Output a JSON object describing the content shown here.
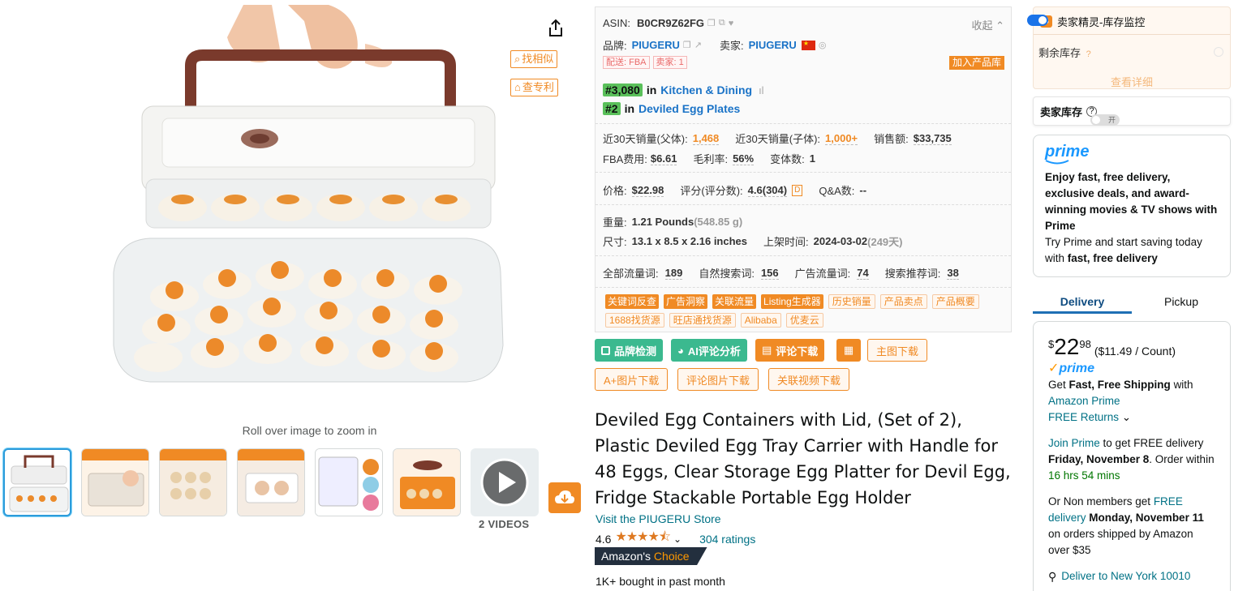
{
  "media": {
    "share_icon": "share-icon",
    "find_similar": "找相似",
    "check_patent": "查专利",
    "zoom_hint": "Roll over image to zoom in",
    "videos_label": "2 VIDEOS"
  },
  "plugin": {
    "asin_label": "ASIN:",
    "asin": "B0CR9Z62FG",
    "collapse": "收起",
    "brand_label": "品牌:",
    "brand": "PIUGERU",
    "seller_label": "卖家:",
    "seller": "PIUGERU",
    "ship_tag": "配送: FBA",
    "seller_count_tag": "卖家: 1",
    "add_library": "加入产品库",
    "rank1_badge": "#3,080",
    "rank1_in": "in",
    "rank1_cat": "Kitchen & Dining",
    "rank2_badge": "#2",
    "rank2_in": "in",
    "rank2_cat": "Deviled Egg Plates",
    "sales30_parent_label": "近30天销量(父体):",
    "sales30_parent": "1,468",
    "sales30_child_label": "近30天销量(子体):",
    "sales30_child": "1,000+",
    "revenue_label": "销售额:",
    "revenue": "$33,735",
    "fba_label": "FBA费用:",
    "fba": "$6.61",
    "margin_label": "毛利率:",
    "margin": "56%",
    "variants_label": "变体数:",
    "variants": "1",
    "price_label": "价格:",
    "price": "$22.98",
    "rating_label": "评分(评分数):",
    "rating": "4.6(304)",
    "rating_tag": "D",
    "qa_label": "Q&A数:",
    "qa": "--",
    "weight_label": "重量:",
    "weight": "1.21 Pounds",
    "weight_g": "(548.85 g)",
    "size_label": "尺寸:",
    "size": "13.1 x 8.5 x 2.16 inches",
    "listed_label": "上架时间:",
    "listed": "2024-03-02",
    "listed_days": "(249天)",
    "kw_all_label": "全部流量词:",
    "kw_all": "189",
    "kw_organic_label": "自然搜索词:",
    "kw_organic": "156",
    "kw_ad_label": "广告流量词:",
    "kw_ad": "74",
    "kw_rec_label": "搜索推荐词:",
    "kw_rec": "38",
    "tags_row1": [
      "关键词反查",
      "广告洞察",
      "关联流量",
      "Listing生成器"
    ],
    "tags_row1_light": [
      "历史销量",
      "产品卖点",
      "产品概要"
    ],
    "tags_row2": [
      "1688找货源",
      "旺店通找货源",
      "Alibaba",
      "优麦云"
    ]
  },
  "actions": {
    "brand_check": "品牌检测",
    "ai_review": "AI评论分析",
    "review_download": "评论下载",
    "main_img_download": "主图下载",
    "aplus_download": "A+图片下载",
    "review_img_download": "评论图片下载",
    "video_download": "关联视频下载"
  },
  "product": {
    "title": "Deviled Egg Containers with Lid, (Set of 2), Plastic Deviled Egg Tray Carrier with Handle for 48 Eggs, Clear Storage Egg Platter for Devil Egg, Fridge Stackable Portable Egg Holder",
    "store": "Visit the PIUGERU Store",
    "rating": "4.6",
    "stars": "★★★★⯪",
    "rating_value": 4.6,
    "ratings_count": "304 ratings",
    "choice_prefix": "Amazon's",
    "choice_word": "Choice",
    "bought": "1K+ bought in past month"
  },
  "right": {
    "monitor_title": "卖家精灵-库存监控",
    "remaining_label": "剩余库存",
    "view_details": "查看详细",
    "seller_stock": "卖家库存",
    "seller_stock_toggle": "开",
    "prime_logo": "prime",
    "prime_bold": "Enjoy fast, free delivery, exclusive deals, and award-winning movies & TV shows with Prime",
    "prime_try": "Try Prime and start saving today with",
    "prime_try_bold": "fast, free delivery",
    "tab_delivery": "Delivery",
    "tab_pickup": "Pickup",
    "price_symbol": "$",
    "price_whole": "22",
    "price_frac": "98",
    "price_unit": "($11.49 / Count)",
    "get_prefix": "Get",
    "fast_free": "Fast, Free Shipping",
    "with": "with",
    "amazon_prime": "Amazon Prime",
    "free_returns": "FREE Returns",
    "join_prime": "Join Prime",
    "join_rest": "to get FREE delivery",
    "delivery_date": "Friday, November 8",
    "order_within": ". Order within",
    "countdown": "16 hrs 54 mins",
    "non_members": "Or Non members get",
    "free_delivery": "FREE delivery",
    "nm_date": "Monday, November 11",
    "nm_rest": "on orders shipped by Amazon over $35",
    "deliver_to": "Deliver to New York 10010"
  },
  "colors": {
    "accent_orange": "#f08a24",
    "teal_link": "#007185",
    "plugin_green": "#3bb98f",
    "prime_blue": "#1a98ff"
  }
}
